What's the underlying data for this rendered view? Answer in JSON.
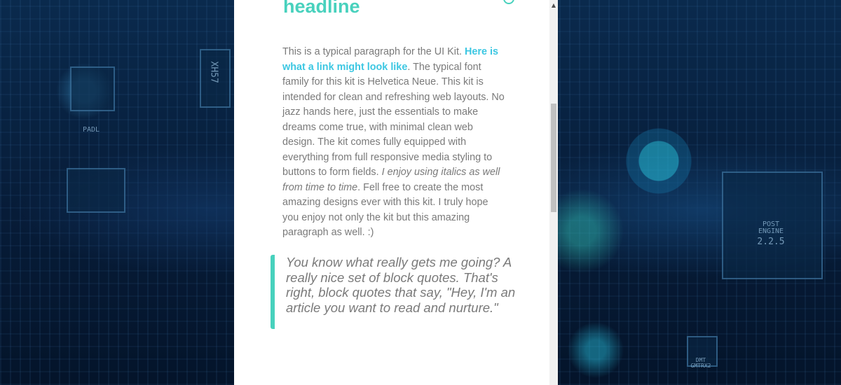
{
  "article": {
    "headline": "headline",
    "paragraph": {
      "intro": "This is a typical paragraph for the UI Kit. ",
      "link": "Here is what a link might look like",
      "after_link": ". The typical font family for this kit is Helvetica Neue. This kit is intended for clean and refreshing web layouts. No jazz hands here, just the essentials to make dreams come true, with minimal clean web design. The kit comes fully equipped with everything from full responsive media styling to buttons to form fields. ",
      "italic": "I enjoy using italics as well from time to time",
      "outro": ". Fell free to create the most amazing designs ever with this kit. I truly hope you enjoy not only the kit but this amazing paragraph as well. :)"
    },
    "blockquote": "You know what really gets me going? A really nice set of block quotes. That's right, block quotes that say, \"Hey, I'm an article you want to read and nurture.\""
  },
  "background": {
    "chip_labels": [
      "XH57",
      "PADL",
      "POST",
      "ENGINE",
      "2.2.5",
      "DMT",
      "GMTRX2"
    ]
  },
  "colors": {
    "accent": "#48d1bd",
    "link": "#3cc7e2",
    "body_text": "#7a7a7a"
  },
  "icons": {
    "scroll_up": "triangle-up"
  }
}
